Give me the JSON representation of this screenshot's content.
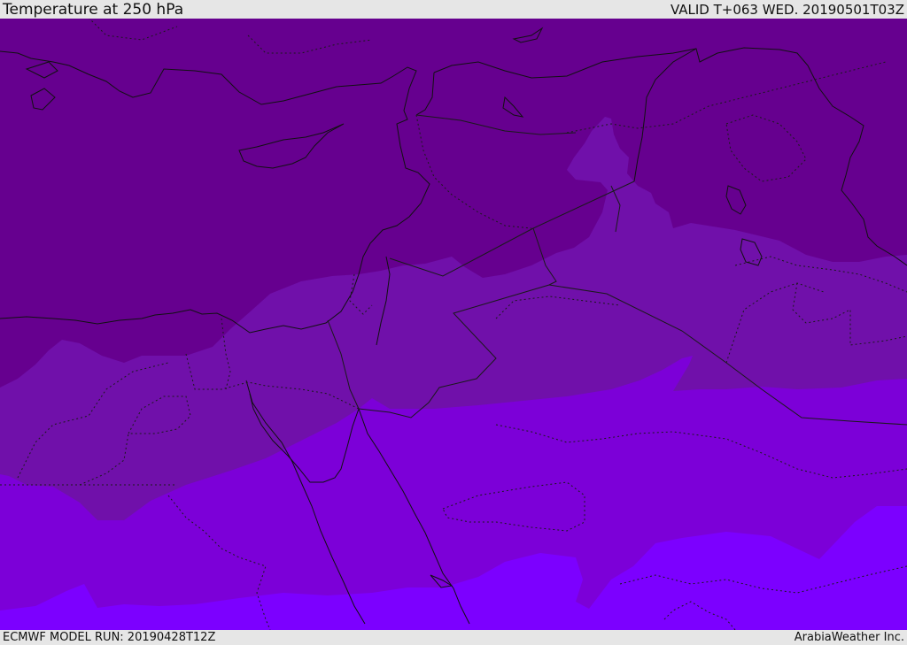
{
  "header": {
    "title": "Temperature at 250 hPa",
    "valid": "VALID T+063 WED. 20190501T03Z"
  },
  "footer": {
    "model_run": "ECMWF MODEL RUN: 20190428T12Z",
    "credit": "ArabiaWeather Inc."
  },
  "colors": {
    "band_coldest": "#66008f",
    "band_cold": "#7010aa",
    "band_mid": "#7c00d8",
    "band_warm": "#7c00ff",
    "coastline": "#111111",
    "border": "#1a1a1a",
    "frame": "#e6e6e6"
  }
}
